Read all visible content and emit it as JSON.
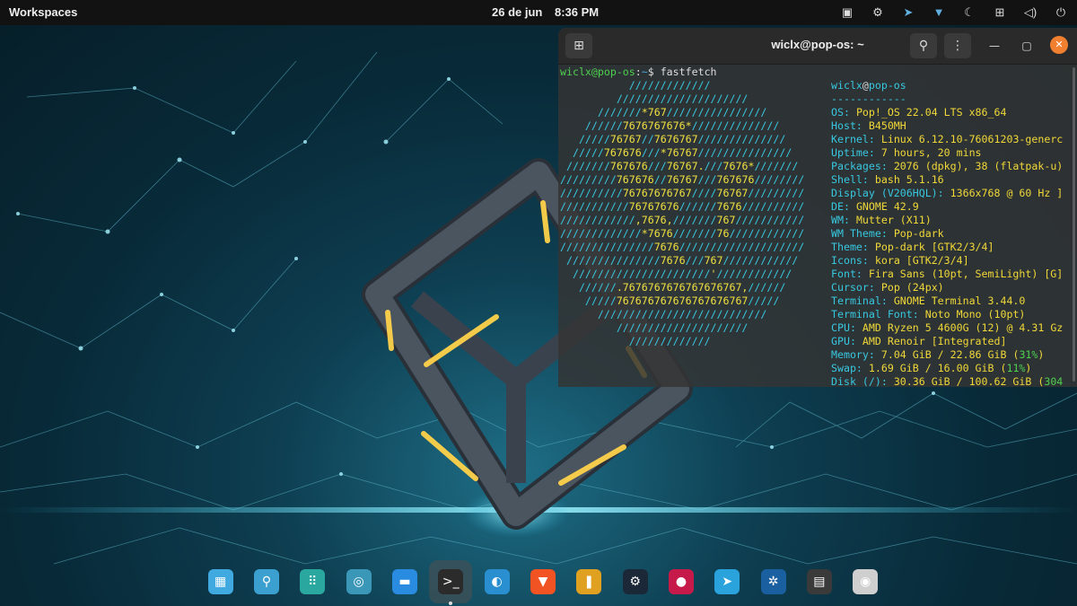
{
  "topbar": {
    "workspaces_label": "Workspaces",
    "date": "26 de jun",
    "time": "8:36 PM",
    "tray_icons": [
      "screen-share-icon",
      "steam-icon",
      "telegram-icon",
      "vpn-shield-icon",
      "night-light-icon",
      "network-icon",
      "volume-icon",
      "power-icon"
    ]
  },
  "terminal": {
    "title": "wiclx@pop-os: ~",
    "prompt_user": "wiclx@pop-os",
    "prompt_sep": ":",
    "prompt_path": "~",
    "prompt_symbol": "$ ",
    "command": "fastfetch",
    "logo_lines": [
      "           /////////////",
      "         /////////////////////",
      "      ///////*767////////////////",
      "    //////7676767676*//////////////",
      "   /////76767//7676767//////////////",
      "  /////767676///*76767///////////////",
      " ///////767676///76767.///7676*///////",
      "/////////767676//76767///767676////////",
      "//////////76767676767////76767/////////",
      "///////////76767676//////7676//////////",
      "////////////,7676,///////767///////////",
      "/////////////*7676///////76////////////",
      "///////////////7676////////////////////",
      " ///////////////7676///767////////////",
      "  //////////////////////'////////////",
      "   //////.7676767676767676767,//////",
      "    /////767676767676767676767/////",
      "      ///////////////////////////",
      "         /////////////////////",
      "           /////////////"
    ],
    "header_user": "wiclx",
    "header_at": "@",
    "header_host": "pop-os",
    "separator": "------------",
    "info": [
      {
        "key": "OS",
        "value": "Pop!_OS 22.04 LTS x86_64"
      },
      {
        "key": "Host",
        "value": "B450MH"
      },
      {
        "key": "Kernel",
        "value": "Linux 6.12.10-76061203-generc"
      },
      {
        "key": "Uptime",
        "value": "7 hours, 20 mins"
      },
      {
        "key": "Packages",
        "value": "2076 (dpkg), 38 (flatpak-u)"
      },
      {
        "key": "Shell",
        "value": "bash 5.1.16"
      },
      {
        "key": "Display (V206HQL)",
        "value": "1366x768 @ 60 Hz ]"
      },
      {
        "key": "DE",
        "value": "GNOME 42.9"
      },
      {
        "key": "WM",
        "value": "Mutter (X11)"
      },
      {
        "key": "WM Theme",
        "value": "Pop-dark"
      },
      {
        "key": "Theme",
        "value": "Pop-dark [GTK2/3/4]"
      },
      {
        "key": "Icons",
        "value": "kora [GTK2/3/4]"
      },
      {
        "key": "Font",
        "value": "Fira Sans (10pt, SemiLight) [G]"
      },
      {
        "key": "Cursor",
        "value": "Pop (24px)"
      },
      {
        "key": "Terminal",
        "value": "GNOME Terminal 3.44.0"
      },
      {
        "key": "Terminal Font",
        "value": "Noto Mono (10pt)"
      },
      {
        "key": "CPU",
        "value": "AMD Ryzen 5 4600G (12) @ 4.31 Gz"
      },
      {
        "key": "GPU",
        "value": "AMD Renoir [Integrated]"
      },
      {
        "key": "Memory",
        "value": "7.04 GiB / 22.86 GiB",
        "pct": "31%"
      },
      {
        "key": "Swap",
        "value": "1.69 GiB / 16.00 GiB",
        "pct": "11%"
      },
      {
        "key": "Disk (/)",
        "value": "30.36 GiB / 100.62 GiB",
        "pct": "304"
      }
    ]
  },
  "dock": {
    "items": [
      {
        "name": "workspaces-app-icon",
        "glyph": "▦",
        "bg": "#3fa9e0"
      },
      {
        "name": "search-app-icon",
        "glyph": "⚲",
        "bg": "#3b9fcf"
      },
      {
        "name": "app-grid-icon",
        "glyph": "⠿",
        "bg": "#2aa8a0"
      },
      {
        "name": "timeshift-icon",
        "glyph": "◎",
        "bg": "#3a97b8"
      },
      {
        "name": "files-icon",
        "glyph": "▬",
        "bg": "#2a8ce0"
      },
      {
        "name": "terminal-icon",
        "glyph": ">_",
        "bg": "#2b2b2b"
      },
      {
        "name": "browser-icon",
        "glyph": "◐",
        "bg": "#2a8fd0"
      },
      {
        "name": "brave-icon",
        "glyph": "▼",
        "bg": "#f25322"
      },
      {
        "name": "protonvpn-icon",
        "glyph": "❚",
        "bg": "#e0a020"
      },
      {
        "name": "steam-icon",
        "glyph": "⚙",
        "bg": "#1b2838"
      },
      {
        "name": "raspberry-pi-imager-icon",
        "glyph": "●",
        "bg": "#c51a4a"
      },
      {
        "name": "telegram-icon",
        "glyph": "➤",
        "bg": "#2aa3dd"
      },
      {
        "name": "settings-icon",
        "glyph": "✲",
        "bg": "#1a5fa0"
      },
      {
        "name": "system-monitor-icon",
        "glyph": "▤",
        "bg": "#3a3a3a"
      },
      {
        "name": "drive-icon",
        "glyph": "◉",
        "bg": "#cfcfcf"
      }
    ],
    "active_index": 5
  }
}
